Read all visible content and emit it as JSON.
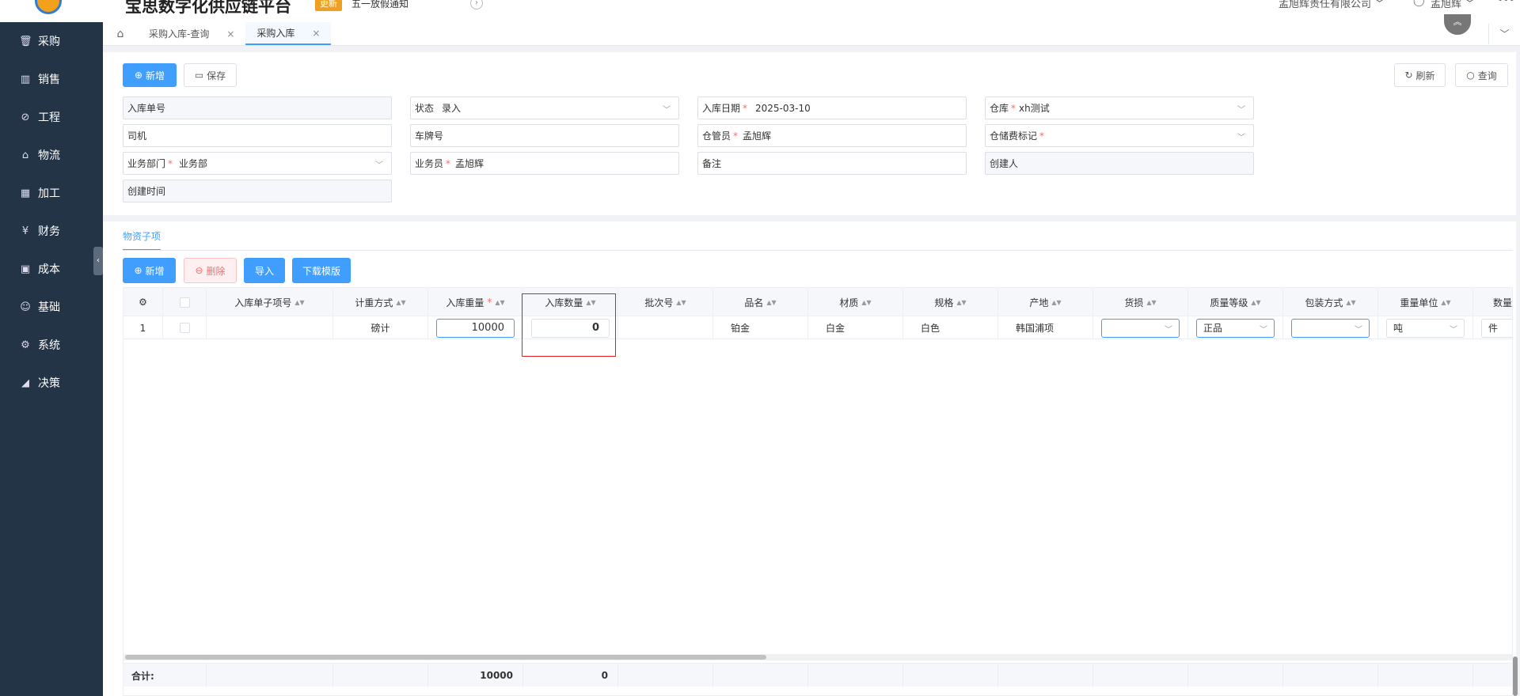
{
  "header": {
    "brand": "宝思数字化供应链平台",
    "badge": "更新",
    "notice": "五一放假通知",
    "company": "孟旭辉责任有限公司",
    "user": "孟旭辉",
    "notice_arrow_icon": "chevron-right-circle-icon",
    "more_icon": "ellipsis-icon"
  },
  "sidebar": {
    "items": [
      {
        "label": "采购",
        "icon": "cart-icon"
      },
      {
        "label": "销售",
        "icon": "bar-chart-icon"
      },
      {
        "label": "工程",
        "icon": "compass-icon"
      },
      {
        "label": "物流",
        "icon": "home-icon"
      },
      {
        "label": "加工",
        "icon": "factory-icon"
      },
      {
        "label": "财务",
        "icon": "yen-icon"
      },
      {
        "label": "成本",
        "icon": "calculator-icon"
      },
      {
        "label": "基础",
        "icon": "smile-icon"
      },
      {
        "label": "系统",
        "icon": "gear-icon"
      },
      {
        "label": "决策",
        "icon": "area-chart-icon"
      }
    ]
  },
  "tabs": {
    "items": [
      {
        "label": "采购入库-查询",
        "active": false
      },
      {
        "label": "采购入库",
        "active": true
      }
    ],
    "close_glyph": "×"
  },
  "toolbar": {
    "new_label": "新增",
    "save_label": "保存",
    "refresh_label": "刷新",
    "query_label": "查询"
  },
  "form": {
    "receipt_no": {
      "label": "入库单号",
      "value": ""
    },
    "status": {
      "label": "状态",
      "value": "录入"
    },
    "date": {
      "label": "入库日期",
      "value": "2025-03-10"
    },
    "warehouse": {
      "label": "仓库",
      "value": "xh测试"
    },
    "driver": {
      "label": "司机",
      "value": ""
    },
    "plate": {
      "label": "车牌号",
      "value": ""
    },
    "keeper": {
      "label": "仓管员",
      "value": "孟旭辉"
    },
    "storage_fee": {
      "label": "仓储费标记",
      "value": ""
    },
    "department": {
      "label": "业务部门",
      "value": "业务部"
    },
    "salesman": {
      "label": "业务员",
      "value": "孟旭辉"
    },
    "remark": {
      "label": "备注",
      "value": ""
    },
    "creator": {
      "label": "创建人",
      "value": ""
    },
    "created_time": {
      "label": "创建时间",
      "value": ""
    },
    "required_mark": "*"
  },
  "detail": {
    "tab_label": "物资子项",
    "new_label": "新增",
    "delete_label": "删除",
    "import_label": "导入",
    "download_label": "下载模版",
    "columns": [
      "入库单子项号",
      "计重方式",
      "入库重量",
      "入库数量",
      "批次号",
      "品名",
      "材质",
      "规格",
      "产地",
      "货损",
      "质量等级",
      "包装方式",
      "重量单位",
      "数量"
    ],
    "row": {
      "index": "1",
      "item_no": "",
      "weigh_method": "磅计",
      "weight": "10000",
      "quantity": "0",
      "batch": "",
      "product": "铂金",
      "material": "白金",
      "spec": "白色",
      "origin": "韩国浦项",
      "damage": "",
      "quality": "正品",
      "packing": "",
      "weight_unit": "吨",
      "qty_unit": "件"
    },
    "footer": {
      "label": "合计:",
      "weight": "10000",
      "quantity": "0"
    }
  }
}
